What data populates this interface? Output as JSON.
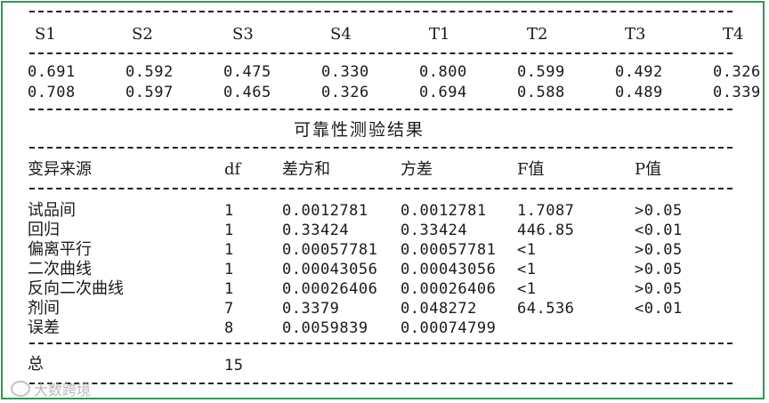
{
  "sample_table": {
    "headers": [
      "S1",
      "S2",
      "S3",
      "S4",
      "T1",
      "T2",
      "T3",
      "T4"
    ],
    "rows": [
      [
        "0.691",
        "0.592",
        "0.475",
        "0.330",
        "0.800",
        "0.599",
        "0.492",
        "0.326"
      ],
      [
        "0.708",
        "0.597",
        "0.465",
        "0.326",
        "0.694",
        "0.588",
        "0.489",
        "0.339"
      ]
    ]
  },
  "section_title": "可靠性测验结果",
  "anova": {
    "headers": [
      "变异来源",
      "df",
      "差方和",
      "方差",
      "F值",
      "P值"
    ],
    "rows": [
      [
        "试品间",
        "1",
        "0.0012781",
        "0.0012781",
        "1.7087",
        ">0.05"
      ],
      [
        "回归",
        "1",
        "0.33424",
        "0.33424",
        "446.85",
        "<0.01"
      ],
      [
        "偏离平行",
        "1",
        "0.00057781",
        "0.00057781",
        "<1",
        ">0.05"
      ],
      [
        "二次曲线",
        "1",
        "0.00043056",
        "0.00043056",
        "<1",
        ">0.05"
      ],
      [
        "反向二次曲线",
        "1",
        "0.00026406",
        "0.00026406",
        "<1",
        ">0.05"
      ],
      [
        "剂间",
        "7",
        "0.3379",
        "0.048272",
        "64.536",
        "<0.01"
      ],
      [
        "误差",
        "8",
        "0.0059839",
        "0.00074799",
        "",
        ""
      ]
    ],
    "total": [
      "总",
      "15"
    ]
  },
  "watermark": "大数跨境",
  "colors": {
    "border": "#2e9a55"
  }
}
